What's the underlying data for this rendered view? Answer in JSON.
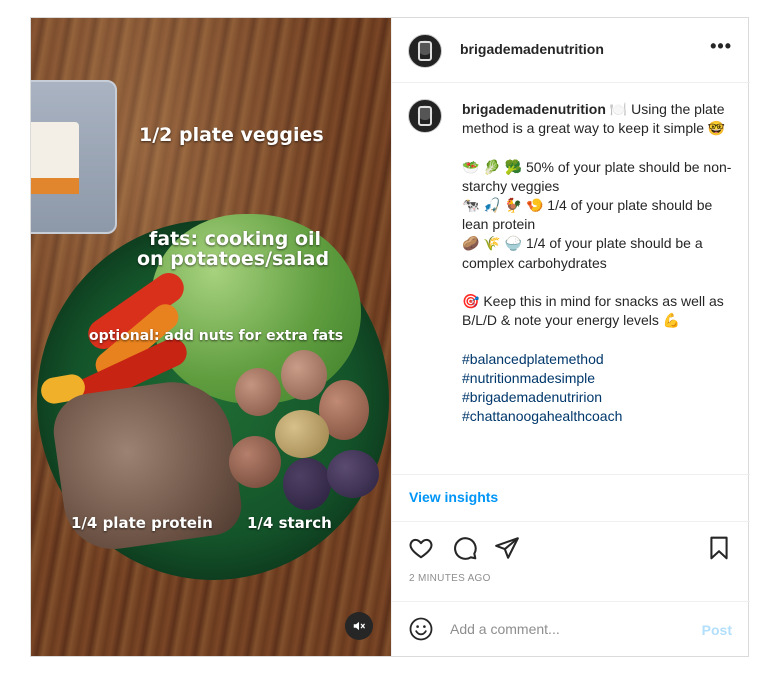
{
  "media": {
    "overlay_veggies": "1/2 plate veggies",
    "overlay_fats_line1": "fats: cooking oil",
    "overlay_fats_line2": "on potatoes/salad",
    "overlay_optional": "optional: add nuts for extra fats",
    "overlay_protein": "1/4 plate protein",
    "overlay_starch": "1/4 starch",
    "mute_icon": "speaker-muted-icon"
  },
  "header": {
    "username": "brigademadenutrition",
    "more_icon": "more-options-icon"
  },
  "caption": {
    "username": "brigademadenutrition",
    "lines": [
      "🍽️ Using the plate method is a great way to keep it simple 🤓",
      "",
      "🥗 🥬 🥦 50% of your plate should be non-starchy veggies",
      "🐄 🎣 🐓 🍤 1/4 of your plate should be lean protein",
      "🥔 🌾 🍚 1/4 of your plate should be a complex carbohydrates",
      "",
      "🎯 Keep this in mind for snacks as well as B/L/D & note your energy levels 💪"
    ],
    "hashtags": [
      "#balancedplatemethod",
      "#nutritionmadesimple",
      "#brigademadenutririon",
      "#chattanoogahealthcoach"
    ]
  },
  "insights_label": "View insights",
  "actions": {
    "like_icon": "heart-icon",
    "comment_icon": "comment-icon",
    "share_icon": "share-icon",
    "save_icon": "bookmark-icon",
    "timestamp": "2 MINUTES AGO"
  },
  "comment_box": {
    "placeholder": "Add a comment...",
    "post_label": "Post",
    "emoji_icon": "emoji-icon"
  },
  "colors": {
    "link_blue": "#0095f6",
    "hashtag_blue": "#00376b",
    "post_disabled": "#b2dffc"
  }
}
